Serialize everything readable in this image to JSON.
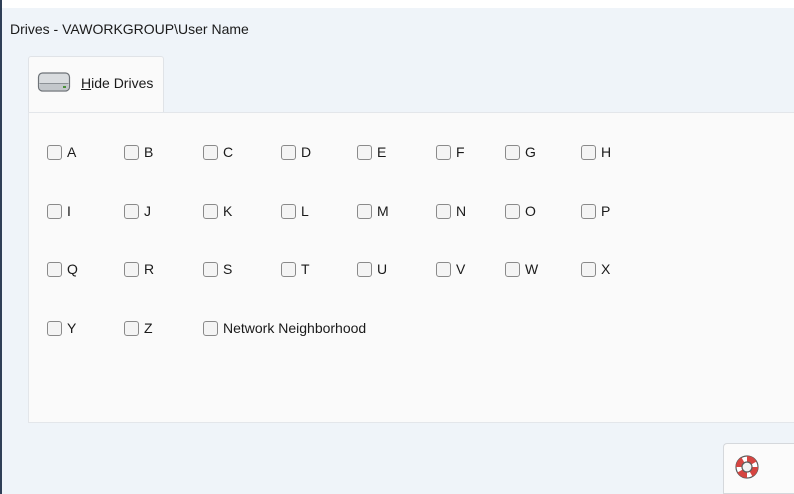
{
  "window": {
    "title": "Drives - VAWORKGROUP\\User Name"
  },
  "tab": {
    "mnemonic": "H",
    "label_rest": "ide Drives",
    "icon": "drive-icon"
  },
  "drives": {
    "A": "A",
    "B": "B",
    "C": "C",
    "D": "D",
    "E": "E",
    "F": "F",
    "G": "G",
    "H": "H",
    "I": "I",
    "J": "J",
    "K": "K",
    "L": "L",
    "M": "M",
    "N": "N",
    "O": "O",
    "P": "P",
    "Q": "Q",
    "R": "R",
    "S": "S",
    "T": "T",
    "U": "U",
    "V": "V",
    "W": "W",
    "X": "X",
    "Y": "Y",
    "Z": "Z",
    "network": "Network Neighborhood"
  },
  "help_button": {
    "icon": "lifebuoy-icon"
  },
  "colors": {
    "window_bg": "#eff4f9",
    "panel_bg": "#fafafa",
    "lifebuoy_red": "#d64541"
  }
}
